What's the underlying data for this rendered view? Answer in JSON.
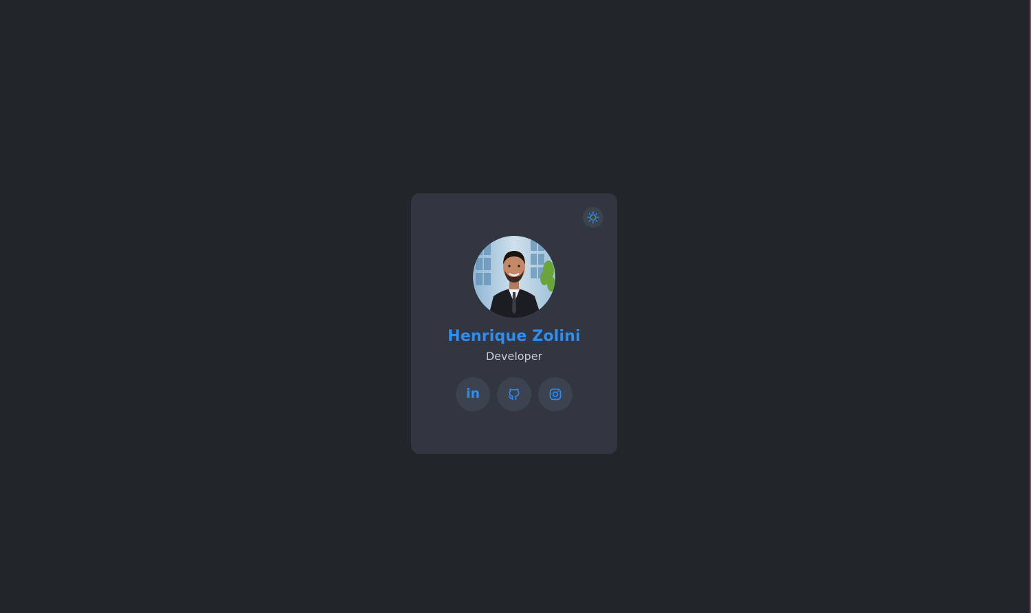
{
  "profile": {
    "name": "Henrique Zolini",
    "role": "Developer",
    "avatar_alt": "Henrique Zolini photo"
  },
  "theme_toggle": {
    "icon": "sun-icon",
    "label": "Toggle theme"
  },
  "socials": [
    {
      "name": "linkedin",
      "icon": "linkedin-icon",
      "glyph": "in"
    },
    {
      "name": "github",
      "icon": "github-icon"
    },
    {
      "name": "instagram",
      "icon": "instagram-icon"
    }
  ],
  "colors": {
    "background": "#22262b",
    "card": "#313640",
    "accent": "#2f8ef0",
    "button_bg": "#3c424e",
    "muted_text": "#c9ccd3"
  }
}
